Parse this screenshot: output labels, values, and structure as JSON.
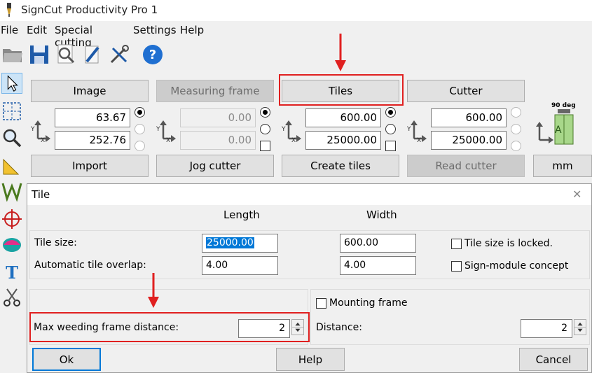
{
  "app": {
    "title": "SignCut Productivity Pro 1"
  },
  "menu": [
    "File",
    "Edit",
    "Special cutting",
    "Settings",
    "Help"
  ],
  "toolbar": {
    "icons": [
      "open-folder-icon",
      "save-icon",
      "zoom-document-icon",
      "edit-pen-icon",
      "tools-icon",
      "help-icon"
    ]
  },
  "left_tools": [
    "pointer-icon",
    "grid-select-icon",
    "zoom-icon",
    "ruler-icon",
    "weed-icon",
    "crosshair-icon",
    "color-icon",
    "text-icon",
    "scissors-icon"
  ],
  "panels": {
    "image": {
      "top_label": "Image",
      "x_value": "63.67",
      "y_value": "252.76",
      "bottom_label": "Import"
    },
    "measuring": {
      "top_label": "Measuring frame",
      "x_value": "0.00",
      "y_value": "0.00",
      "bottom_label": "Jog cutter"
    },
    "tiles": {
      "top_label": "Tiles",
      "x_value": "600.00",
      "y_value": "25000.00",
      "bottom_label": "Create tiles"
    },
    "cutter": {
      "top_label": "Cutter",
      "x_value": "600.00",
      "y_value": "25000.00",
      "bottom_label": "Read cutter"
    },
    "orientation": {
      "deg_label": "90 deg",
      "unit_label": "mm"
    },
    "axis_x": "X",
    "axis_y": "Y"
  },
  "dialog": {
    "title": "Tile",
    "close_glyph": "✕",
    "col_length": "Length",
    "col_width": "Width",
    "tile_size_label": "Tile size:",
    "tile_size_length": "25000.00",
    "tile_size_width": "600.00",
    "overlap_label": "Automatic tile overlap:",
    "overlap_length": "4.00",
    "overlap_width": "4.00",
    "locked_label": "Tile size is locked.",
    "sign_module_label": "Sign-module concept",
    "max_weeding_label": "Max weeding frame distance:",
    "max_weeding_value": "2",
    "mounting_frame_label": "Mounting frame",
    "distance_label": "Distance:",
    "distance_value": "2",
    "ok_label": "Ok",
    "help_label": "Help",
    "cancel_label": "Cancel"
  },
  "colors": {
    "highlight_red": "#e02020",
    "selection_blue": "#0078d7"
  }
}
